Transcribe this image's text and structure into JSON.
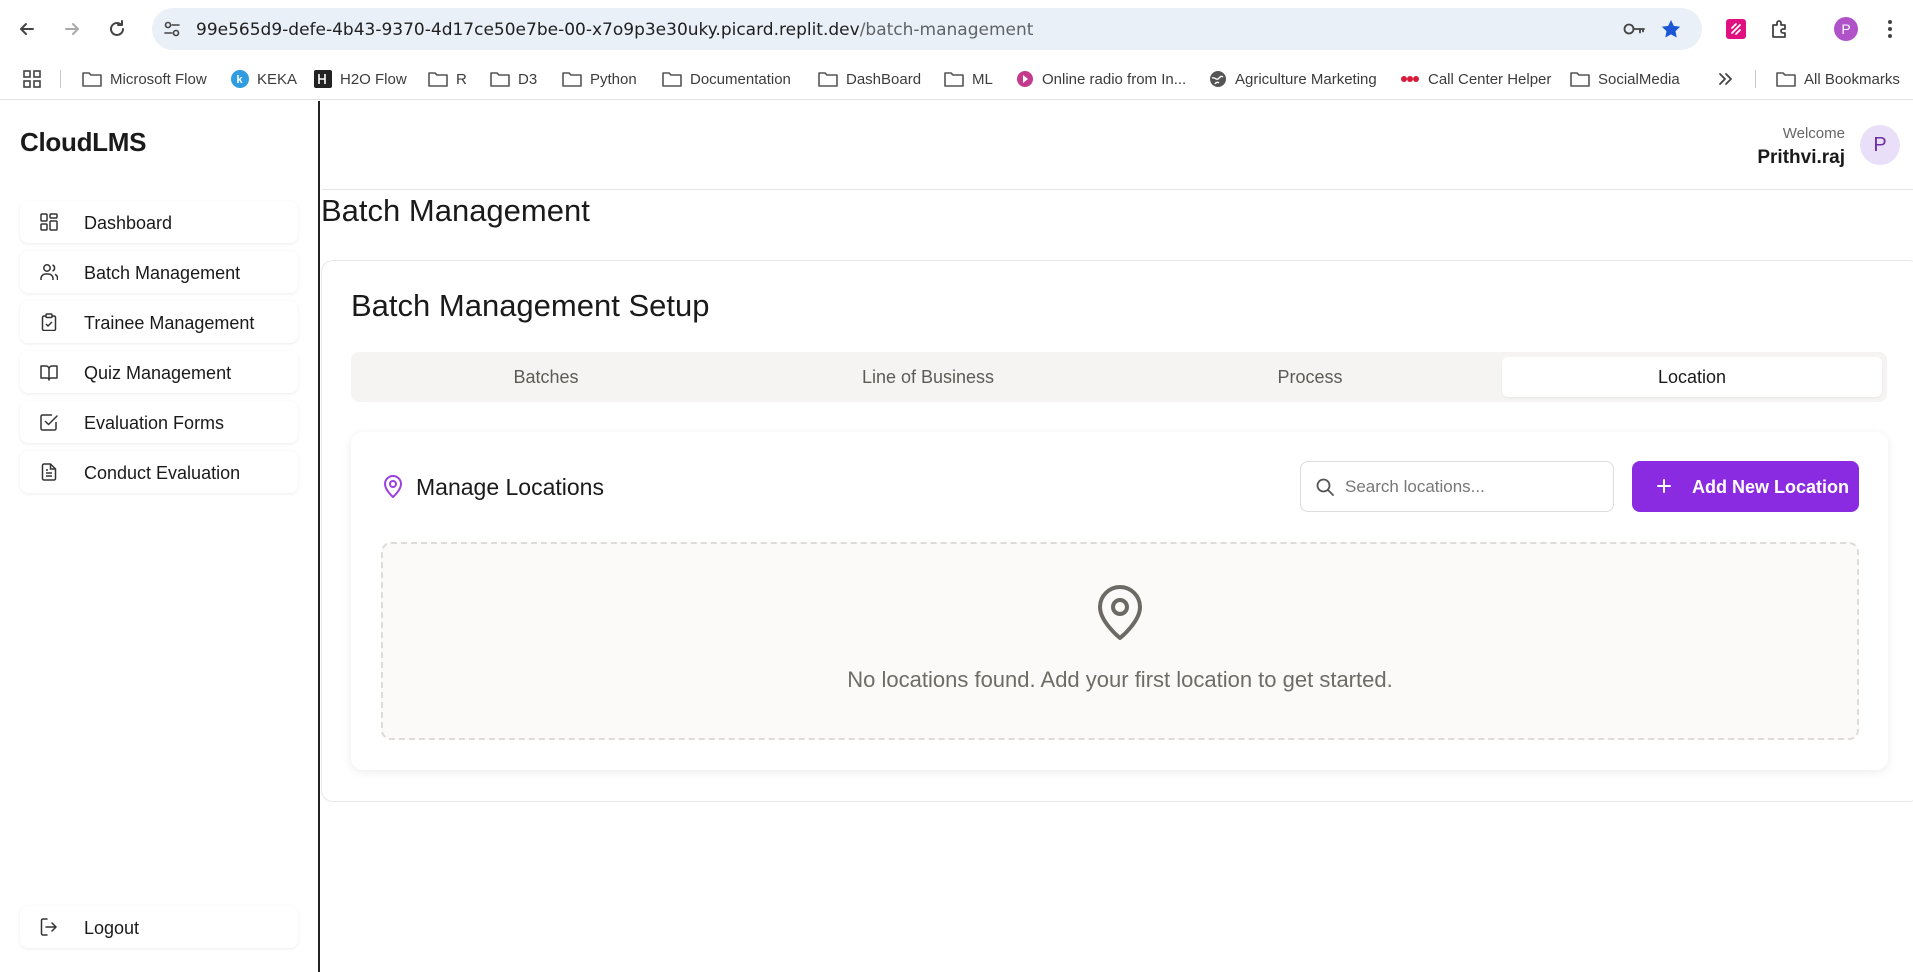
{
  "browser": {
    "url_host": "99e565d9-defe-4b43-9370-4d17ce50e7be-00-x7o9p3e30uky.picard.replit.dev",
    "url_path": "/batch-management",
    "profile_initial": "P",
    "bookmarks": [
      {
        "label": "Microsoft Flow",
        "icon": "folder-icon"
      },
      {
        "label": "KEKA",
        "icon": "keka-icon"
      },
      {
        "label": "H2O Flow",
        "icon": "h2o-icon"
      },
      {
        "label": "R",
        "icon": "folder-icon"
      },
      {
        "label": "D3",
        "icon": "folder-icon"
      },
      {
        "label": "Python",
        "icon": "folder-icon"
      },
      {
        "label": "Documentation",
        "icon": "folder-icon"
      },
      {
        "label": "DashBoard",
        "icon": "folder-icon"
      },
      {
        "label": "ML",
        "icon": "folder-icon"
      },
      {
        "label": "Online radio from In...",
        "icon": "radio-icon"
      },
      {
        "label": "Agriculture Marketing",
        "icon": "globe-icon"
      },
      {
        "label": "Call Center Helper",
        "icon": "dots-icon"
      },
      {
        "label": "SocialMedia",
        "icon": "folder-icon"
      }
    ],
    "all_bookmarks": "All Bookmarks"
  },
  "app": {
    "brand": "CloudLMS",
    "welcome": "Welcome",
    "username": "Prithvi.raj",
    "avatar_initial": "P",
    "accent_color": "#8a2be2",
    "sidebar": {
      "items": [
        {
          "label": "Dashboard",
          "icon": "grid-icon"
        },
        {
          "label": "Batch Management",
          "icon": "users-icon"
        },
        {
          "label": "Trainee Management",
          "icon": "clipboard-icon"
        },
        {
          "label": "Quiz Management",
          "icon": "book-icon"
        },
        {
          "label": "Evaluation Forms",
          "icon": "check-square-icon"
        },
        {
          "label": "Conduct Evaluation",
          "icon": "file-text-icon"
        }
      ],
      "logout": "Logout"
    },
    "page_title": "Batch Management",
    "setup_title": "Batch Management Setup",
    "tabs": [
      {
        "label": "Batches",
        "active": false
      },
      {
        "label": "Line of Business",
        "active": false
      },
      {
        "label": "Process",
        "active": false
      },
      {
        "label": "Location",
        "active": true
      }
    ],
    "manage": {
      "title": "Manage Locations",
      "search_placeholder": "Search locations...",
      "add_button": "Add New Location",
      "empty_text": "No locations found. Add your first location to get started."
    }
  }
}
